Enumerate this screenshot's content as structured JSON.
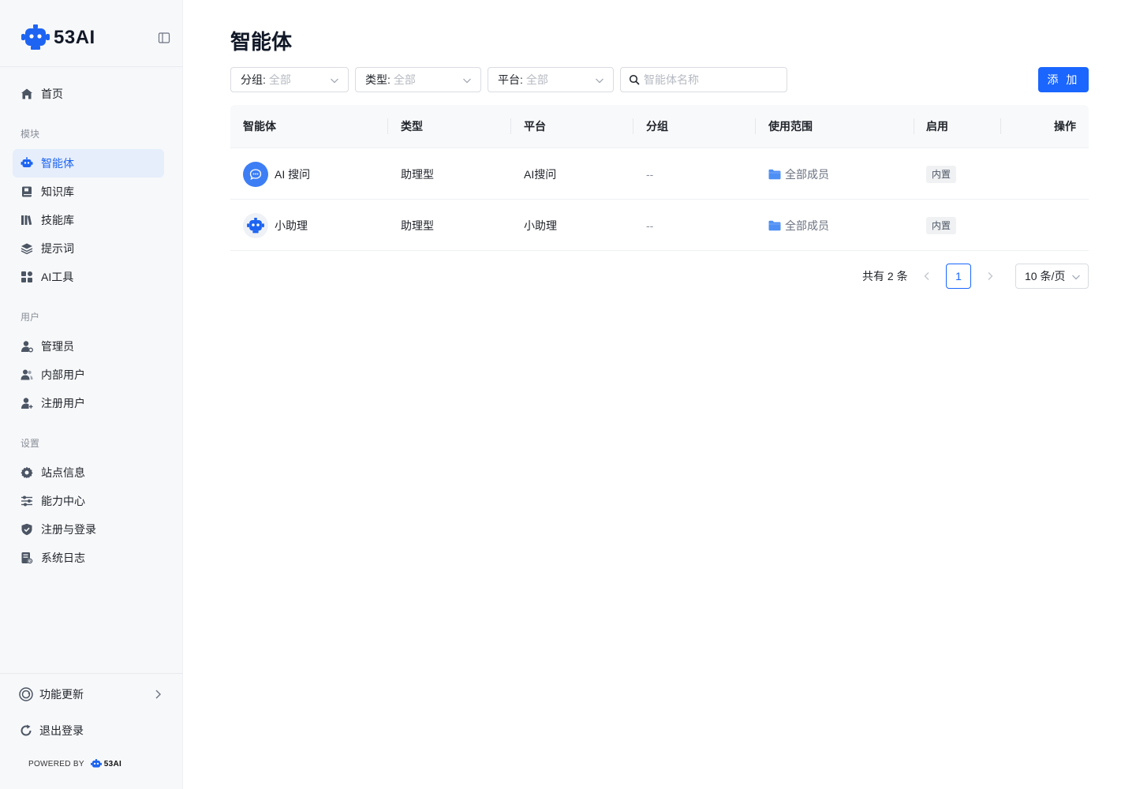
{
  "brand": {
    "name": "53AI"
  },
  "sidebar": {
    "home": "首页",
    "section_module": "模块",
    "module_items": [
      "智能体",
      "知识库",
      "技能库",
      "提示词",
      "AI工具"
    ],
    "section_user": "用户",
    "user_items": [
      "管理员",
      "内部用户",
      "注册用户"
    ],
    "section_settings": "设置",
    "settings_items": [
      "站点信息",
      "能力中心",
      "注册与登录",
      "系统日志"
    ],
    "active_item": "智能体",
    "updates": "功能更新",
    "logout": "退出登录",
    "powered_by": "POWERED BY",
    "powered_brand": "53AI"
  },
  "page": {
    "title": "智能体"
  },
  "filters": {
    "group_label": "分组:",
    "group_value": "全部",
    "type_label": "类型:",
    "type_value": "全部",
    "platform_label": "平台:",
    "platform_value": "全部"
  },
  "search": {
    "placeholder": "智能体名称",
    "value": ""
  },
  "toolbar": {
    "add_label": "添 加"
  },
  "table": {
    "columns": [
      "智能体",
      "类型",
      "平台",
      "分组",
      "使用范围",
      "启用",
      "操作"
    ],
    "rows": [
      {
        "name": "AI 搜问",
        "type": "助理型",
        "platform": "AI搜问",
        "group": "--",
        "scope": "全部成员",
        "status": "内置"
      },
      {
        "name": "小助理",
        "type": "助理型",
        "platform": "小助理",
        "group": "--",
        "scope": "全部成员",
        "status": "内置"
      }
    ]
  },
  "pagination": {
    "total_text": "共有 2 条",
    "current_page": "1",
    "page_size": "10 条/页"
  },
  "colors": {
    "accent": "#1a66ff",
    "active_bg": "#e6eefc",
    "sidebar_bg": "#f7f8fa"
  },
  "icons": {
    "home": "home-icon",
    "agent": "robot-icon",
    "knowledge": "book-icon",
    "skills": "library-icon",
    "prompts": "layers-icon",
    "ai_tools": "apps-icon",
    "admin": "user-gear-icon",
    "internal_users": "users-icon",
    "registered_users": "user-add-icon",
    "site_info": "gear-icon",
    "capability": "sliders-icon",
    "auth": "shield-icon",
    "logs": "log-icon",
    "updates": "refresh-circle-icon",
    "logout": "logout-icon"
  }
}
